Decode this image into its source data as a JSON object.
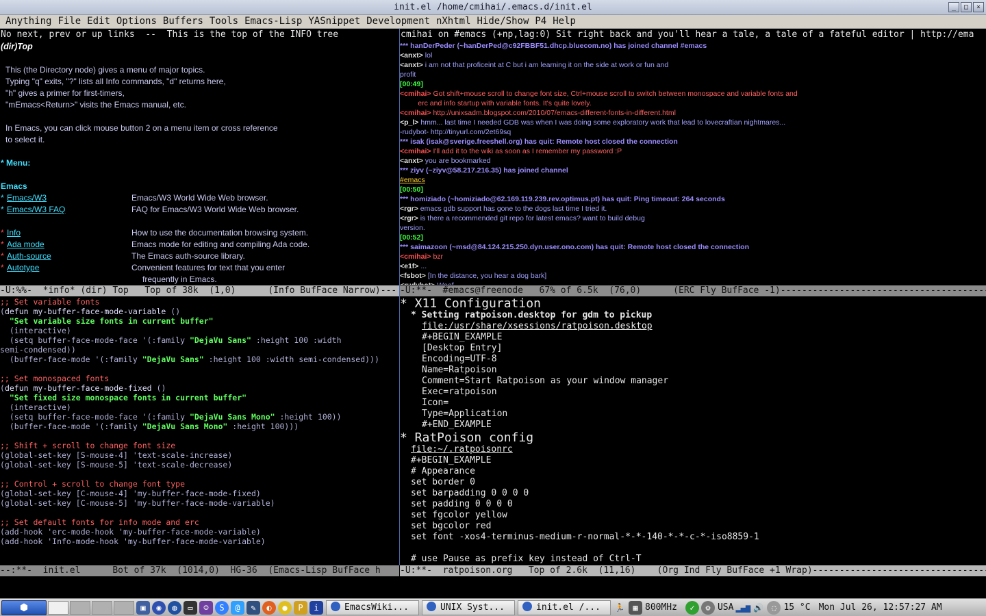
{
  "window": {
    "title": "init.el /home/cmihai/.emacs.d/init.el"
  },
  "menu": [
    "Anything",
    "File",
    "Edit",
    "Options",
    "Buffers",
    "Tools",
    "Emacs-Lisp",
    "YASnippet",
    "Development",
    "nXhtml",
    "Hide/Show",
    "P4",
    "Help"
  ],
  "info": {
    "header": "No next, prev or up links  --  This is the top of the INFO tree",
    "node": "(dir)Top",
    "intro": [
      "This (the Directory node) gives a menu of major topics.",
      "Typing \"q\" exits, \"?\" lists all Info commands, \"d\" returns here,",
      "\"h\" gives a primer for first-timers,",
      "\"mEmacs<Return>\" visits the Emacs manual, etc."
    ],
    "intro2": [
      "In Emacs, you can click mouse button 2 on a menu item or cross reference",
      "to select it."
    ],
    "menu_label": "* Menu:",
    "section": "Emacs",
    "items": [
      {
        "name": "Emacs/W3",
        "desc": "Emacs/W3 World Wide Web browser."
      },
      {
        "name": "Emacs/W3 FAQ",
        "desc": "FAQ for Emacs/W3 World Wide Web browser."
      },
      {
        "name": "Info",
        "desc": "How to use the documentation browsing system."
      },
      {
        "name": "Ada mode",
        "desc": "Emacs mode for editing and compiling Ada code."
      },
      {
        "name": "Auth-source",
        "desc": "The Emacs auth-source library."
      },
      {
        "name": "Autotype",
        "desc": "Convenient features for text that you enter"
      }
    ],
    "continuation": "frequently in Emacs.",
    "modeline": "-U:%%-  *info* (dir) Top   Top of 38k  (1,0)      (Info BufFace Narrow)---"
  },
  "erc": {
    "header": "cmihai on #emacs (+np,lag:0) Sit right back and you'll hear a tale, a tale of a fateful editor | http://ema",
    "lines": [
      {
        "cls": "join",
        "text": "*** hanDerPeder (~hanDerPed@c92FBBF51.dhcp.bluecom.no) has joined channel #emacs"
      },
      {
        "cls": "nick",
        "nick": "<anxt>",
        "text": " lol"
      },
      {
        "cls": "nick",
        "nick": "<anxt>",
        "text": " i am not that proficeint at C but i am learning it on the side at work or fun and"
      },
      {
        "cls": "normal",
        "text": "profit"
      },
      {
        "cls": "ts",
        "text": "[00:49]"
      },
      {
        "cls": "me",
        "nick": "<cmihai>",
        "text": " Got shift+mouse scroll to change font size, Ctrl+mouse scroll to switch between monospace and variable fonts and"
      },
      {
        "cls": "me",
        "text": "         erc and info startup with variable fonts. It's quite lovely."
      },
      {
        "cls": "me",
        "nick": "<cmihai>",
        "text": " http://unixsadm.blogspot.com/2010/07/emacs-different-fonts-in-different.html"
      },
      {
        "cls": "nick",
        "nick": "<p_l>",
        "text": " hmm... last time I needed GDB was when I was doing some exploratory work that lead to lovecraftian nightmares..."
      },
      {
        "cls": "bot",
        "text": "-rudybot- http://tinyurl.com/2et69sq"
      },
      {
        "cls": "join",
        "text": "*** isak (isak@sverige.freeshell.org) has quit: Remote host closed the connection"
      },
      {
        "cls": "me",
        "nick": "<cmihai>",
        "text": " I'll add it to the wiki as soon as I remember my password :P"
      },
      {
        "cls": "nick",
        "nick": "<anxt>",
        "text": " you are bookmarked"
      },
      {
        "cls": "join",
        "text": "*** ziyv (~ziyv@58.217.216.35) has joined channel"
      },
      {
        "cls": "url",
        "text": "#emacs"
      },
      {
        "cls": "ts",
        "text": "[00:50]"
      },
      {
        "cls": "join",
        "text": "*** homiziado (~homiziado@62.169.119.239.rev.optimus.pt) has quit: Ping timeout: 264 seconds"
      },
      {
        "cls": "nick",
        "nick": "<rgr>",
        "text": " emacs gdb support has gone to the dogs last time I tried it."
      },
      {
        "cls": "nick",
        "nick": "<rgr>",
        "text": " is there a recommended git repo for latest emacs? want to build debug"
      },
      {
        "cls": "normal",
        "text": "version."
      },
      {
        "cls": "ts",
        "text": "[00:52]"
      },
      {
        "cls": "join",
        "text": "*** saimazoon (~msd@84.124.215.250.dyn.user.ono.com) has quit: Remote host closed the connection"
      },
      {
        "cls": "me",
        "nick": "<cmihai>",
        "text": " bzr"
      },
      {
        "cls": "nick",
        "nick": "<e1f>",
        "text": " ..."
      },
      {
        "cls": "nick",
        "nick": "<fsbot>",
        "text": " [In the distance, you hear a dog bark]"
      },
      {
        "cls": "nick",
        "nick": "<rudybot>",
        "text": " Woof"
      }
    ],
    "modeline": "-U:**-  #emacs@freenode   67% of 6.5k  (76,0)      (ERC Fly BufFace -1)------------------------------------------"
  },
  "elisp": {
    "lines": [
      [
        {
          "c": "cm",
          "t": ";; Set variable fonts"
        }
      ],
      [
        {
          "c": "plain",
          "t": "("
        },
        {
          "c": "kw",
          "t": "defun"
        },
        {
          "c": "plain",
          "t": " "
        },
        {
          "c": "kw",
          "t": "my-buffer-face-mode-variable"
        },
        {
          "c": "plain",
          "t": " ()"
        }
      ],
      [
        {
          "c": "plain",
          "t": "  "
        },
        {
          "c": "str",
          "t": "\"Set variable size fonts in current buffer\""
        }
      ],
      [
        {
          "c": "plain",
          "t": "  (interactive)"
        }
      ],
      [
        {
          "c": "plain",
          "t": "  (setq buffer-face-mode-face '(:family "
        },
        {
          "c": "str",
          "t": "\"DejaVu Sans\""
        },
        {
          "c": "plain",
          "t": " :height 100 :width"
        }
      ],
      [
        {
          "c": "plain",
          "t": "semi-condensed))"
        }
      ],
      [
        {
          "c": "plain",
          "t": "  (buffer-face-mode '(:family "
        },
        {
          "c": "str",
          "t": "\"DejaVu Sans\""
        },
        {
          "c": "plain",
          "t": " :height 100 :width semi-condensed)))"
        }
      ],
      [],
      [
        {
          "c": "cm",
          "t": ";; Set monospaced fonts"
        }
      ],
      [
        {
          "c": "plain",
          "t": "("
        },
        {
          "c": "kw",
          "t": "defun"
        },
        {
          "c": "plain",
          "t": " "
        },
        {
          "c": "kw",
          "t": "my-buffer-face-mode-fixed"
        },
        {
          "c": "plain",
          "t": " ()"
        }
      ],
      [
        {
          "c": "plain",
          "t": "  "
        },
        {
          "c": "str",
          "t": "\"Set fixed size monospace fonts in current buffer\""
        }
      ],
      [
        {
          "c": "plain",
          "t": "  (interactive)"
        }
      ],
      [
        {
          "c": "plain",
          "t": "  (setq buffer-face-mode-face '(:family "
        },
        {
          "c": "str",
          "t": "\"DejaVu Sans Mono\""
        },
        {
          "c": "plain",
          "t": " :height 100))"
        }
      ],
      [
        {
          "c": "plain",
          "t": "  (buffer-face-mode '(:family "
        },
        {
          "c": "str",
          "t": "\"DejaVu Sans Mono\""
        },
        {
          "c": "plain",
          "t": " :height 100)))"
        }
      ],
      [],
      [
        {
          "c": "cm",
          "t": ";; Shift + scroll to change font size"
        }
      ],
      [
        {
          "c": "plain",
          "t": "(global-set-key [S-mouse-4] 'text-scale-increase)"
        }
      ],
      [
        {
          "c": "plain",
          "t": "(global-set-key [S-mouse-5] 'text-scale-decrease)"
        }
      ],
      [],
      [
        {
          "c": "cm",
          "t": ";; Control + scroll to change font type"
        }
      ],
      [
        {
          "c": "plain",
          "t": "(global-set-key [C-mouse-4] 'my-buffer-face-mode-fixed)"
        }
      ],
      [
        {
          "c": "plain",
          "t": "(global-set-key [C-mouse-5] 'my-buffer-face-mode-variable)"
        }
      ],
      [],
      [
        {
          "c": "cm",
          "t": ";; Set default fonts for info mode and erc"
        }
      ],
      [
        {
          "c": "plain",
          "t": "(add-hook 'erc-mode-hook 'my-buffer-face-mode-variable)"
        }
      ],
      [
        {
          "c": "plain",
          "t": "(add-hook 'Info-mode-hook 'my-buffer-face-mode-variable)"
        }
      ]
    ],
    "modeline": "--:**-  init.el      Bot of 37k  (1014,0)  HG-36  (Emacs-Lisp BufFace h"
  },
  "org": {
    "lines": [
      {
        "c": "h1",
        "i": 0,
        "t": "* X11 Configuration"
      },
      {
        "c": "h2",
        "i": 1,
        "t": "* Setting ratpoison.desktop for gdm to pickup"
      },
      {
        "c": "lnk",
        "i": 2,
        "t": "file:/usr/share/xsessions/ratpoison.desktop"
      },
      {
        "c": "blk",
        "i": 2,
        "t": "#+BEGIN_EXAMPLE"
      },
      {
        "c": "",
        "i": 2,
        "t": "[Desktop Entry]"
      },
      {
        "c": "",
        "i": 2,
        "t": "Encoding=UTF-8"
      },
      {
        "c": "",
        "i": 2,
        "t": "Name=Ratpoison"
      },
      {
        "c": "",
        "i": 2,
        "t": "Comment=Start Ratpoison as your window manager"
      },
      {
        "c": "",
        "i": 2,
        "t": "Exec=ratpoison"
      },
      {
        "c": "",
        "i": 2,
        "t": "Icon="
      },
      {
        "c": "",
        "i": 2,
        "t": "Type=Application"
      },
      {
        "c": "blk",
        "i": 2,
        "t": "#+END_EXAMPLE"
      },
      {
        "c": "h1",
        "i": 0,
        "t": "* RatPoison config"
      },
      {
        "c": "lnk",
        "i": 1,
        "t": "file:~/.ratpoisonrc"
      },
      {
        "c": "blk",
        "i": 1,
        "t": "#+BEGIN_EXAMPLE"
      },
      {
        "c": "",
        "i": 1,
        "t": "# Appearance"
      },
      {
        "c": "",
        "i": 1,
        "t": "set border 0"
      },
      {
        "c": "",
        "i": 1,
        "t": "set barpadding 0 0 0 0"
      },
      {
        "c": "",
        "i": 1,
        "t": "set padding 0 0 0 0"
      },
      {
        "c": "",
        "i": 1,
        "t": "set fgcolor yellow"
      },
      {
        "c": "",
        "i": 1,
        "t": "set bgcolor red"
      },
      {
        "c": "",
        "i": 1,
        "t": "set font -xos4-terminus-medium-r-normal-*-*-140-*-*-c-*-iso8859-1"
      },
      {
        "c": "",
        "i": 1,
        "t": ""
      },
      {
        "c": "",
        "i": 1,
        "t": "# use Pause as prefix key instead of Ctrl-T"
      }
    ],
    "modeline": "-U:**-  ratpoison.org   Top of 2.6k  (11,16)    (Org Ind Fly BufFace +1 Wrap)------------------------------------"
  },
  "taskbar": {
    "tasks": [
      "EmacsWiki...",
      "UNIX Syst...",
      "init.el /..."
    ],
    "cpu": "800MHz",
    "layout": "USA",
    "temp": "15 °C",
    "clock": "Mon Jul 26, 12:57:27 AM"
  }
}
